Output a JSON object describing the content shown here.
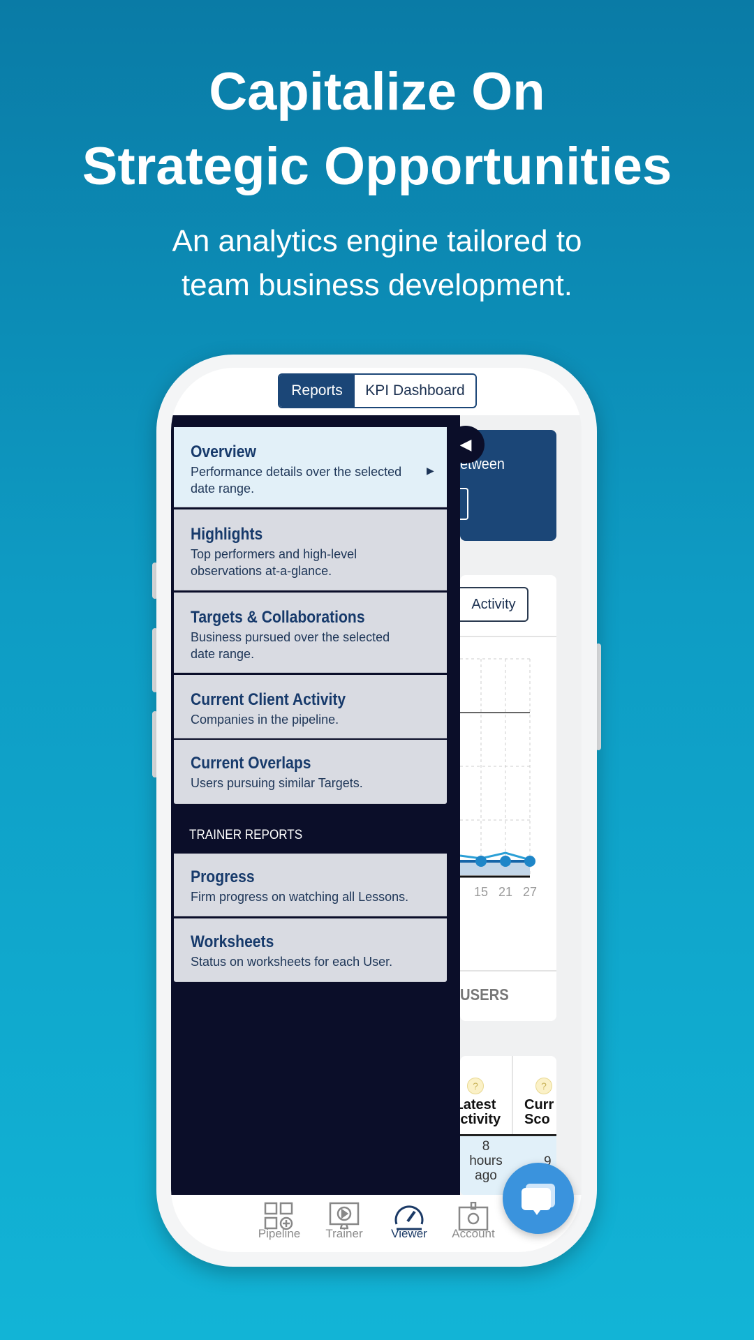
{
  "hero": {
    "title_line1": "Capitalize On",
    "title_line2": "Strategic Opportunities",
    "subtitle_line1": "An analytics engine tailored to",
    "subtitle_line2": "team business development."
  },
  "tabs": {
    "reports": "Reports",
    "kpi": "KPI Dashboard",
    "active": "Reports"
  },
  "drawer": {
    "items": [
      {
        "title": "Overview",
        "desc1": "Performance details over the selected",
        "desc2": "date range.",
        "active": true
      },
      {
        "title": "Highlights",
        "desc1": "Top performers and high-level",
        "desc2": "observations at-a-glance."
      },
      {
        "title": "Targets & Collaborations",
        "desc1": "Business pursued over the selected",
        "desc2": "date range."
      },
      {
        "title": "Current Client Activity",
        "desc1": "Companies in the pipeline."
      },
      {
        "title": "Current Overlaps",
        "desc1": "Users pursuing similar Targets."
      }
    ],
    "section_label": "TRAINER REPORTS",
    "trainer_items": [
      {
        "title": "Progress",
        "desc1": "Firm progress on watching all Lessons."
      },
      {
        "title": "Worksheets",
        "desc1": "Status on worksheets for each User."
      }
    ]
  },
  "main": {
    "date_card_text": "etween",
    "activity_button": "Activity",
    "users_label": "USERS",
    "table": {
      "col1_line1": "Latest",
      "col1_line2": "Activity",
      "col2_line1": "Curr",
      "col2_line2": "Sco",
      "row1_col1_a": "8",
      "row1_col1_b": "hours",
      "row1_col1_c": "ago",
      "row1_col2": "9"
    }
  },
  "chart_data": {
    "type": "line",
    "x": [
      15,
      21,
      27
    ],
    "series": [
      {
        "values": [
          1,
          1,
          1
        ],
        "color": "#1565a8"
      },
      {
        "values": [
          1.2,
          1.6,
          1.1
        ],
        "color": "#2a9fd6"
      }
    ],
    "xticks": [
      "15",
      "21",
      "27"
    ],
    "grid": true
  },
  "nav": {
    "items": [
      {
        "label": "Pipeline",
        "icon": "pipeline-icon"
      },
      {
        "label": "Trainer",
        "icon": "trainer-icon"
      },
      {
        "label": "Viewer",
        "icon": "speedometer-icon",
        "active": true
      },
      {
        "label": "Account",
        "icon": "badge-icon"
      }
    ]
  },
  "colors": {
    "primary": "#1b4677",
    "drawer": "#0b0e29",
    "chat": "#3a93dd"
  }
}
